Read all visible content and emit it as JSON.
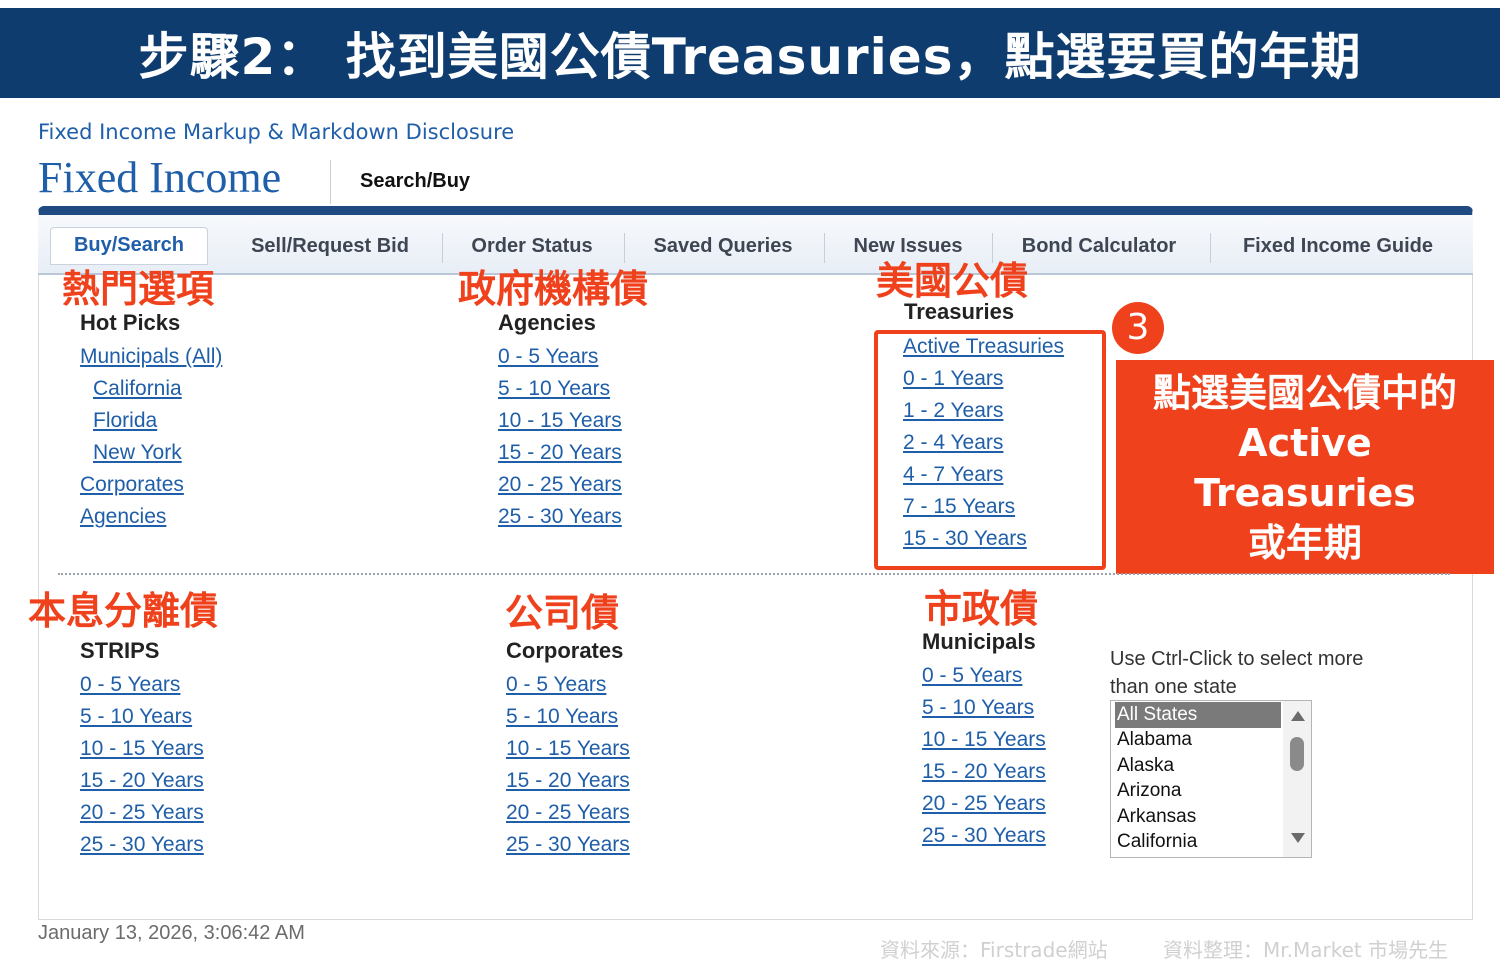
{
  "banner": {
    "text": "步驟2： 找到美國公債Treasuries，點選要買的年期"
  },
  "header": {
    "disclosure": "Fixed Income Markup & Markdown Disclosure",
    "title": "Fixed Income",
    "subtitle": "Search/Buy"
  },
  "tabs": [
    {
      "label": "Buy/Search"
    },
    {
      "label": "Sell/Request Bid"
    },
    {
      "label": "Order Status"
    },
    {
      "label": "Saved Queries"
    },
    {
      "label": "New Issues"
    },
    {
      "label": "Bond Calculator"
    },
    {
      "label": "Fixed Income Guide"
    }
  ],
  "annotations": {
    "hot": "熱門選項",
    "agencies": "政府機構債",
    "treasuries": "美國公債",
    "strips": "本息分離債",
    "corporates": "公司債",
    "municipals": "市政債",
    "step": "3",
    "callout": [
      "點選美國公債中的",
      "Active",
      "Treasuries",
      "或年期"
    ]
  },
  "sections": {
    "hot": {
      "title": "Hot Picks",
      "links": [
        "Municipals (All)",
        "California",
        "Florida",
        "New York",
        "Corporates",
        "Agencies"
      ]
    },
    "agencies": {
      "title": "Agencies",
      "links": [
        "0 - 5 Years",
        "5 - 10 Years",
        "10 - 15 Years",
        "15 - 20 Years",
        "20 - 25 Years",
        "25 - 30 Years"
      ]
    },
    "treasuries": {
      "title": "Treasuries",
      "links": [
        "Active Treasuries",
        "0 - 1 Years",
        "1 - 2 Years",
        "2 - 4 Years",
        "4 - 7 Years",
        "7 - 15 Years",
        "15 - 30 Years"
      ]
    },
    "strips": {
      "title": "STRIPS",
      "links": [
        "0 - 5 Years",
        "5 - 10 Years",
        "10 - 15 Years",
        "15 - 20 Years",
        "20 - 25 Years",
        "25 - 30 Years"
      ]
    },
    "corporates": {
      "title": "Corporates",
      "links": [
        "0 - 5 Years",
        "5 - 10 Years",
        "10 - 15 Years",
        "15 - 20 Years",
        "20 - 25 Years",
        "25 - 30 Years"
      ]
    },
    "municipals": {
      "title": "Municipals",
      "links": [
        "0 - 5 Years",
        "5 - 10 Years",
        "10 - 15 Years",
        "15 - 20 Years",
        "20 - 25 Years",
        "25 - 30 Years"
      ]
    }
  },
  "states": {
    "hint": [
      "Use Ctrl-Click to select more",
      "than one state"
    ],
    "options": [
      "All States",
      "Alabama",
      "Alaska",
      "Arizona",
      "Arkansas",
      "California"
    ],
    "selected": "All States"
  },
  "footer": {
    "timestamp": "January 13, 2026, 3:06:42 AM",
    "source": "資料來源：Firstrade網站",
    "compiled": "資料整理：Mr.Market 市場先生"
  },
  "colors": {
    "banner": "#0f3c6e",
    "accent": "#f0411d",
    "link": "#1f5ea8"
  }
}
